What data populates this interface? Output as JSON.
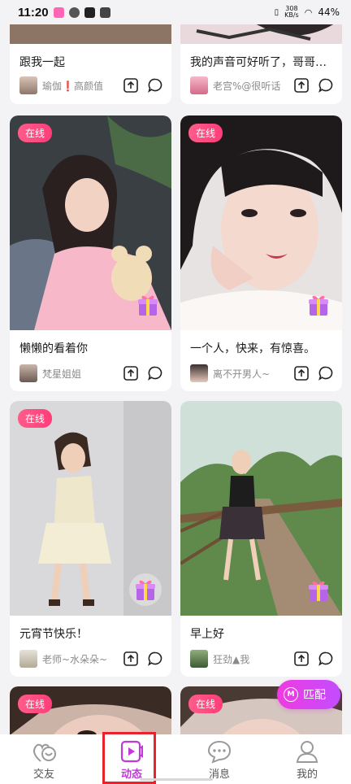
{
  "status": {
    "time": "11:20",
    "speed_top": "308",
    "speed_bottom": "KB/s",
    "battery": "44%"
  },
  "colors": {
    "accent": "#c13ad7",
    "online_badge": "#ff4d85",
    "highlight_box": "#e8232e"
  },
  "cards": [
    {
      "title": "跟我一起",
      "author": "瑜伽❗高颜值",
      "online": "",
      "gift": false
    },
    {
      "title": "我的声音可好听了，哥哥要…",
      "author": "老宫%@很听话",
      "online": "",
      "gift": false
    },
    {
      "title": "懒懒的看着你",
      "author": "梵星姐姐",
      "online": "在线",
      "gift": true
    },
    {
      "title": "一个人，快来，有惊喜。",
      "author": "离不开男人~",
      "online": "在线",
      "gift": true
    },
    {
      "title": "元宵节快乐！",
      "author": "老师~水朵朵~",
      "online": "在线",
      "gift": true
    },
    {
      "title": "早上好",
      "author": "狂劲▲我",
      "online": "",
      "gift": true
    },
    {
      "title": "",
      "author": "",
      "online": "在线",
      "gift": false
    },
    {
      "title": "",
      "author": "",
      "online": "在线",
      "gift": false
    }
  ],
  "match_button": {
    "label": "匹配",
    "icon": "M"
  },
  "tabs": [
    {
      "label": "交友",
      "icon": "friends-icon",
      "active": false
    },
    {
      "label": "动态",
      "icon": "video-feed-icon",
      "active": true
    },
    {
      "label": "消息",
      "icon": "chat-icon",
      "active": false
    },
    {
      "label": "我的",
      "icon": "profile-icon",
      "active": false
    }
  ]
}
